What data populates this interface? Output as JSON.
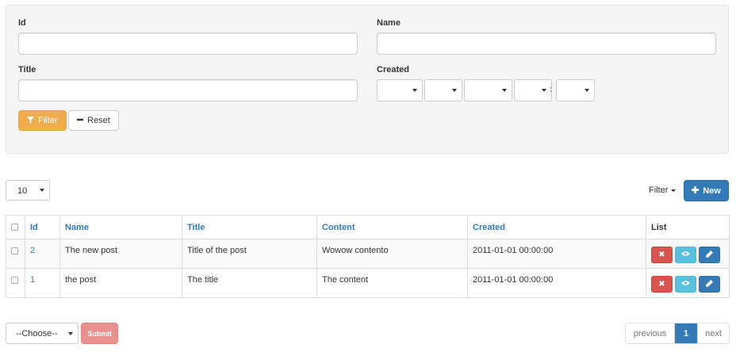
{
  "filter_form": {
    "fields": {
      "id": {
        "label": "Id",
        "value": ""
      },
      "name": {
        "label": "Name",
        "value": ""
      },
      "title": {
        "label": "Title",
        "value": ""
      },
      "created": {
        "label": "Created",
        "separator": ":"
      }
    },
    "filter_button": "Filter",
    "reset_button": "Reset"
  },
  "toolbar": {
    "per_page": "10",
    "filter_dropdown": "Filter",
    "new_button": "New"
  },
  "table": {
    "columns": [
      "Id",
      "Name",
      "Title",
      "Content",
      "Created",
      "List"
    ],
    "rows": [
      {
        "id": "2",
        "name": "The new post",
        "title": "Title of the post",
        "content": "Wowow contento",
        "created": "2011-01-01 00:00:00"
      },
      {
        "id": "1",
        "name": "the post",
        "title": "The title",
        "content": "The content",
        "created": "2011-01-01 00:00:00"
      }
    ]
  },
  "bulk": {
    "select_value": "--Choose--",
    "submit_button": "Submit"
  },
  "pagination": {
    "previous": "previous",
    "current": "1",
    "next": "next"
  },
  "icons": {
    "filter": "filter-icon",
    "reset": "minus-icon",
    "new": "plus-icon",
    "delete": "times-icon",
    "show": "eye-icon",
    "edit": "pencil-icon"
  },
  "colors": {
    "primary": "#337ab7",
    "warning": "#f0ad4e",
    "danger": "#d9534f",
    "info": "#5bc0de",
    "panel_bg": "#f5f5f5"
  }
}
